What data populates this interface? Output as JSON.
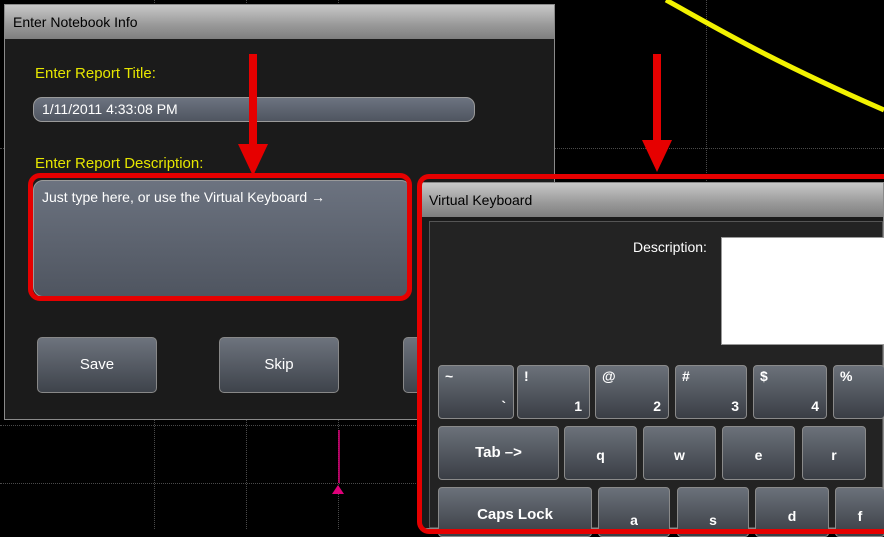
{
  "dialog": {
    "title": "Enter Notebook Info",
    "report_title_label": "Enter Report Title:",
    "report_title_value": "1/11/2011 4:33:08 PM",
    "description_label": "Enter Report Description:",
    "description_value": "Just type here, or use the Virtual Keyboard →",
    "save_label": "Save",
    "skip_label": "Skip"
  },
  "keyboard": {
    "title": "Virtual Keyboard",
    "description_label": "Description:",
    "row1": [
      {
        "top": "~",
        "bottom": "`"
      },
      {
        "top": "!",
        "bottom": "1"
      },
      {
        "top": "@",
        "bottom": "2"
      },
      {
        "top": "#",
        "bottom": "3"
      },
      {
        "top": "$",
        "bottom": "4"
      },
      {
        "top": "%",
        "bottom": ""
      }
    ],
    "row2": [
      "Tab –>",
      "q",
      "w",
      "e",
      "r"
    ],
    "row3": [
      "Caps Lock",
      "a",
      "s",
      "d",
      "f"
    ]
  },
  "colors": {
    "annotation": "#e60000",
    "label_yellow": "#e6e600",
    "trace": "#f2f200",
    "marker": "#e0007a"
  },
  "icons": [
    "arrow-down-icon",
    "trigger-marker-icon"
  ]
}
